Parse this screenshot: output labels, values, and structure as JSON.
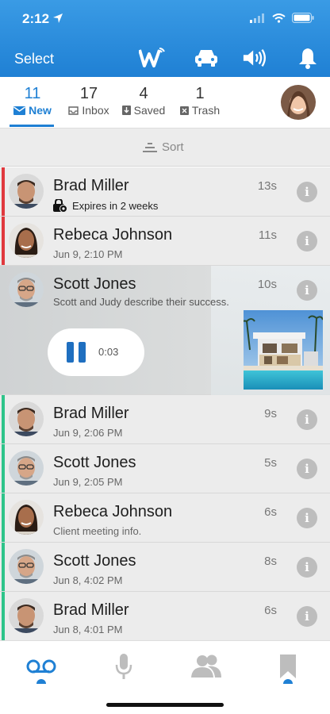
{
  "status_bar": {
    "time": "2:12"
  },
  "toolbar": {
    "select_label": "Select",
    "icons": [
      "w-logo-icon",
      "car-icon",
      "speaker-icon",
      "bell-icon"
    ]
  },
  "tabs": [
    {
      "count": "11",
      "label": "New",
      "icon": "envelope-icon",
      "active": true
    },
    {
      "count": "17",
      "label": "Inbox",
      "icon": "inbox-icon",
      "active": false
    },
    {
      "count": "4",
      "label": "Saved",
      "icon": "save-icon",
      "active": false
    },
    {
      "count": "1",
      "label": "Trash",
      "icon": "trash-icon",
      "active": false
    }
  ],
  "sort_label": "Sort",
  "messages": [
    {
      "name": "Brad Miller",
      "sub": "Expires in 2 weeks",
      "duration": "13s",
      "indicator": "#e0393e",
      "avatar": "brad"
    },
    {
      "name": "Rebeca Johnson",
      "sub": "Jun 9, 2:10 PM",
      "duration": "11s",
      "indicator": "#e0393e",
      "avatar": "rebeca"
    },
    {
      "name": "Scott Jones",
      "sub": "Scott and Judy describe their success.",
      "duration": "10s",
      "indicator": "",
      "avatar": "scott",
      "expanded": true,
      "playback_time": "0:03"
    },
    {
      "name": "Brad Miller",
      "sub": "Jun 9, 2:06 PM",
      "duration": "9s",
      "indicator": "#2ec48a",
      "avatar": "brad"
    },
    {
      "name": "Scott Jones",
      "sub": "Jun 9, 2:05 PM",
      "duration": "5s",
      "indicator": "#2ec48a",
      "avatar": "scott"
    },
    {
      "name": "Rebeca Johnson",
      "sub": "Client meeting info.",
      "duration": "6s",
      "indicator": "#2ec48a",
      "avatar": "rebeca"
    },
    {
      "name": "Scott Jones",
      "sub": "Jun 8, 4:02 PM",
      "duration": "8s",
      "indicator": "#2ec48a",
      "avatar": "scott"
    },
    {
      "name": "Brad Miller",
      "sub": "Jun 8, 4:01 PM",
      "duration": "6s",
      "indicator": "#2ec48a",
      "avatar": "brad"
    }
  ],
  "bottom_nav": [
    "voicemail-icon",
    "microphone-icon",
    "contacts-icon",
    "bookmark-icon"
  ],
  "colors": {
    "brand": "#1f80d4",
    "unread": "#e0393e",
    "new": "#2ec48a"
  }
}
